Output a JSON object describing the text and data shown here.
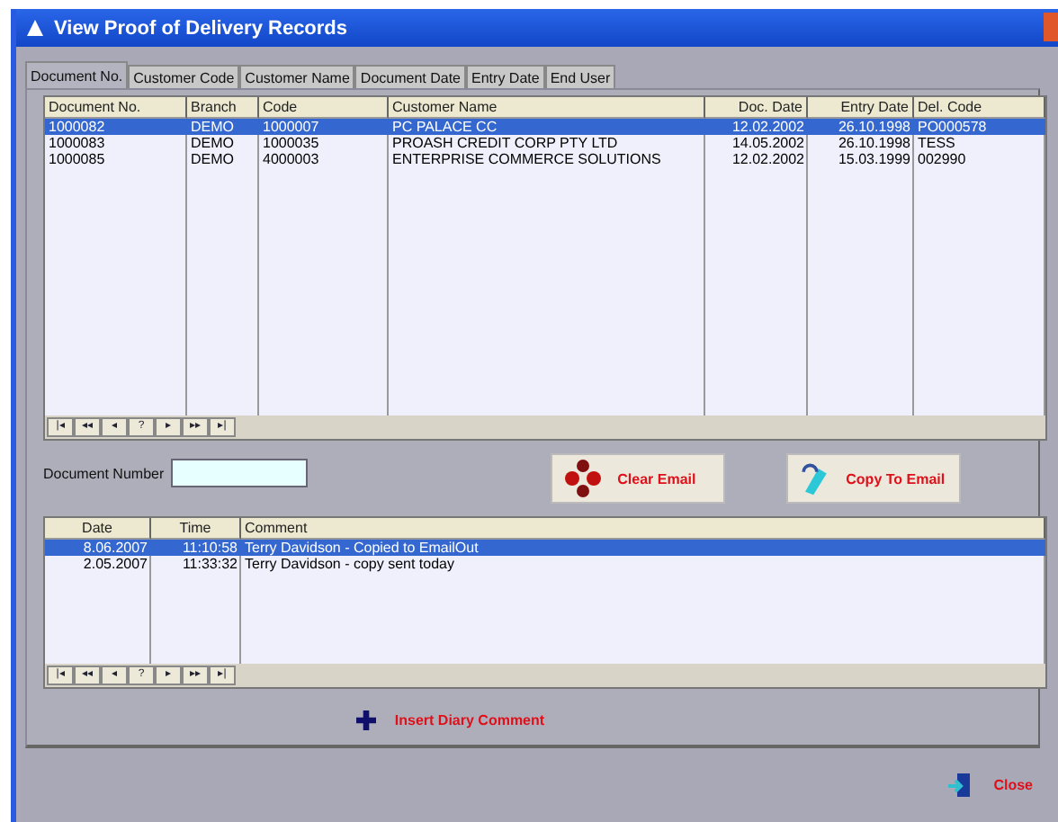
{
  "window": {
    "title": "View Proof of Delivery Records"
  },
  "tabs": [
    {
      "label": "Document No.",
      "selected": true
    },
    {
      "label": "Customer Code",
      "selected": false
    },
    {
      "label": "Customer Name",
      "selected": false
    },
    {
      "label": "Document Date",
      "selected": false
    },
    {
      "label": "Entry Date",
      "selected": false
    },
    {
      "label": "End User",
      "selected": false
    }
  ],
  "records_table": {
    "columns": [
      "Document No.",
      "Branch",
      "Code",
      "Customer Name",
      "Doc. Date",
      "Entry Date",
      "Del. Code"
    ],
    "rows": [
      {
        "cells": [
          "1000082",
          "DEMO",
          "1000007",
          "PC PALACE CC",
          "12.02.2002",
          "26.10.1998",
          "PO000578"
        ],
        "selected": true
      },
      {
        "cells": [
          "1000083",
          "DEMO",
          "1000035",
          "PROASH CREDIT CORP PTY LTD",
          "14.05.2002",
          "26.10.1998",
          "TESS"
        ],
        "selected": false
      },
      {
        "cells": [
          "1000085",
          "DEMO",
          "4000003",
          "ENTERPRISE COMMERCE SOLUTIONS",
          "12.02.2002",
          "15.03.1999",
          "002990"
        ],
        "selected": false
      }
    ],
    "nav_buttons": [
      "|◂",
      "◂◂",
      "◂",
      "?",
      "▸",
      "▸▸",
      "▸|"
    ]
  },
  "document_number": {
    "label": "Document Number"
  },
  "buttons": [
    {
      "kind": "clear",
      "label": "Clear Email"
    },
    {
      "kind": "copy",
      "label": "Copy To Email"
    }
  ],
  "comments_table": {
    "columns": [
      "Date",
      "Time",
      "Comment"
    ],
    "rows": [
      {
        "cells": [
          "8.06.2007",
          "11:10:58",
          "Terry Davidson - Copied to EmailOut"
        ],
        "selected": true
      },
      {
        "cells": [
          "2.05.2007",
          "11:33:32",
          "Terry Davidson - copy sent today"
        ],
        "selected": false
      }
    ],
    "nav_buttons": [
      "|◂",
      "◂◂",
      "◂",
      "?",
      "▸",
      "▸▸",
      "▸|"
    ]
  },
  "insert_button": {
    "label": "Insert Diary Comment"
  },
  "close_button": {
    "label": "Close"
  }
}
